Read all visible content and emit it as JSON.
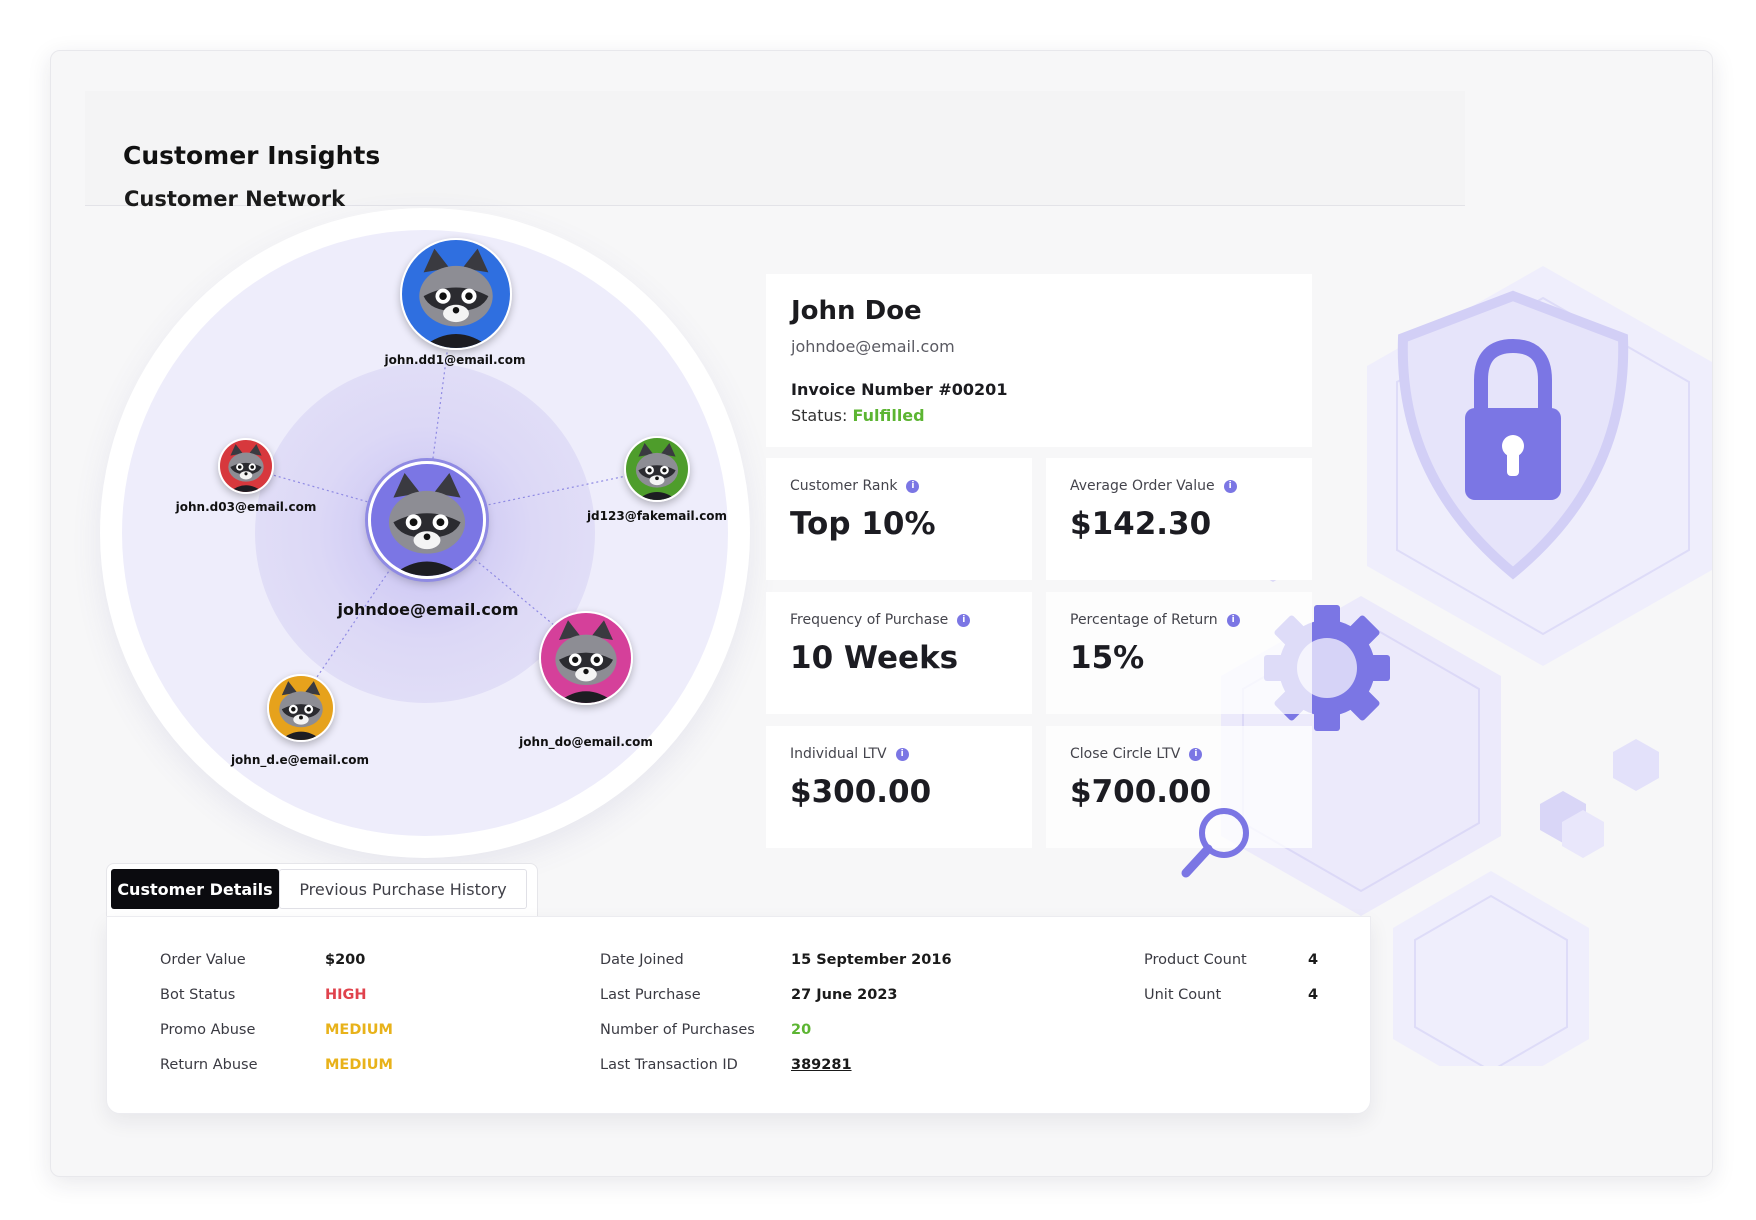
{
  "page": {
    "title": "Customer Insights"
  },
  "network": {
    "section_title": "Customer Network",
    "center": {
      "email": "johndoe@email.com",
      "color": "#7b76e4"
    },
    "nodes": [
      {
        "email": "john.dd1@email.com",
        "color": "#2f6fe0"
      },
      {
        "email": "john.d03@email.com",
        "color": "#d7383d"
      },
      {
        "email": "jd123@fakemail.com",
        "color": "#4e9d2b"
      },
      {
        "email": "john_d.e@email.com",
        "color": "#e6a21c"
      },
      {
        "email": "john_do@email.com",
        "color": "#d5409a"
      }
    ]
  },
  "profile": {
    "name": "John Doe",
    "email": "johndoe@email.com",
    "invoice": "Invoice Number #00201",
    "status_label": "Status:",
    "status_value": "Fulfilled"
  },
  "metrics": [
    {
      "label": "Customer Rank",
      "value": "Top 10%"
    },
    {
      "label": "Average Order Value",
      "value": "$142.30"
    },
    {
      "label": "Frequency of Purchase",
      "value": "10 Weeks"
    },
    {
      "label": "Percentage of Return",
      "value": "15%"
    },
    {
      "label": "Individual LTV",
      "value": "$300.00"
    },
    {
      "label": "Close Circle LTV",
      "value": "$700.00"
    }
  ],
  "tabs": {
    "active": "Customer Details",
    "inactive": "Previous Purchase History"
  },
  "details": {
    "col1": [
      {
        "label": "Order Value",
        "value": "$200"
      },
      {
        "label": "Bot Status",
        "value": "HIGH"
      },
      {
        "label": "Promo Abuse",
        "value": "MEDIUM"
      },
      {
        "label": "Return Abuse",
        "value": "MEDIUM"
      }
    ],
    "col2": [
      {
        "label": "Date Joined",
        "value": "15 September 2016"
      },
      {
        "label": "Last Purchase",
        "value": "27 June 2023"
      },
      {
        "label": "Number of Purchases",
        "value": "20"
      },
      {
        "label": "Last Transaction ID",
        "value": "389281"
      }
    ],
    "col3": [
      {
        "label": "Product Count",
        "value": "4"
      },
      {
        "label": "Unit Count",
        "value": "4"
      }
    ]
  },
  "icons": {
    "security": "shield-lock-icon",
    "settings": "gear-icon",
    "search": "magnifier-icon",
    "info": "info-icon"
  },
  "colors": {
    "accent": "#7b76e4",
    "status_high": "#e0424c",
    "status_medium": "#e8b21a",
    "positive": "#5cb532"
  }
}
